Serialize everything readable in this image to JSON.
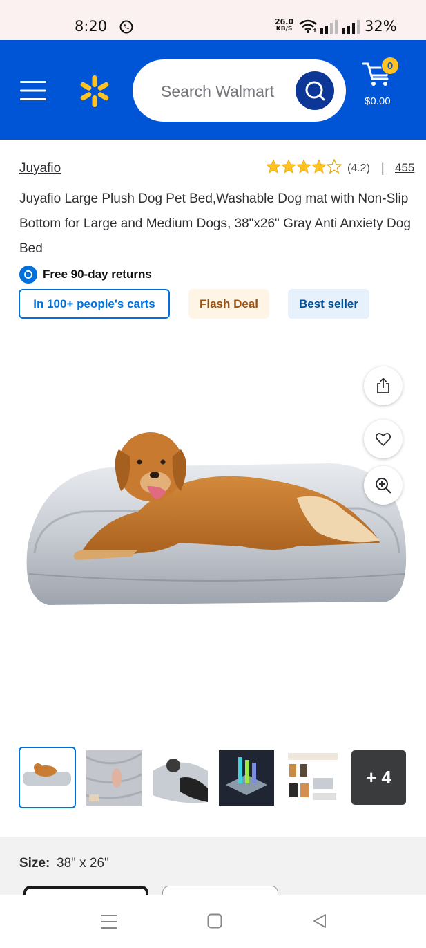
{
  "status": {
    "time": "8:20",
    "speed_value": "26.0",
    "speed_unit": "KB/S",
    "battery": "32%",
    "icons": [
      "whatsapp-icon",
      "wifi-icon",
      "signal-icon",
      "signal-icon"
    ]
  },
  "header": {
    "search_placeholder": "Search Walmart",
    "cart_count": "0",
    "cart_total": "$0.00",
    "brand_color": "#0055d7",
    "accent_color": "#ffc220"
  },
  "product": {
    "brand": "Juyafio",
    "rating": "(4.2)",
    "rating_value": 4.2,
    "separator": "|",
    "review_count": "455",
    "title": "Juyafio Large Plush Dog Pet Bed,Washable Dog mat with Non-Slip Bottom for Large and Medium Dogs, 38\"x26\" Gray Anti Anxiety Dog Bed",
    "returns": "Free 90-day returns",
    "tags": [
      "In 100+ people's carts",
      "Flash Deal",
      "Best seller"
    ]
  },
  "gallery": {
    "more_label": "+ 4"
  },
  "size": {
    "label": "Size:",
    "value": "38\" x 26\""
  }
}
